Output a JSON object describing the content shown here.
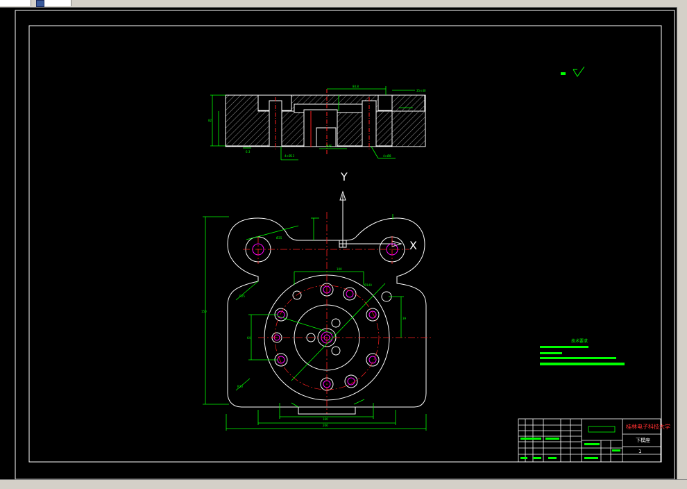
{
  "window": {
    "tab_icon": "document-icon"
  },
  "drawing": {
    "axes": {
      "y_label": "Y",
      "x_label": "X"
    },
    "technical_requirements": {
      "title": "技术要求"
    },
    "title_block": {
      "university": "桂林电子科技大学",
      "part_name": "下模座",
      "sheet_number": "1"
    }
  }
}
